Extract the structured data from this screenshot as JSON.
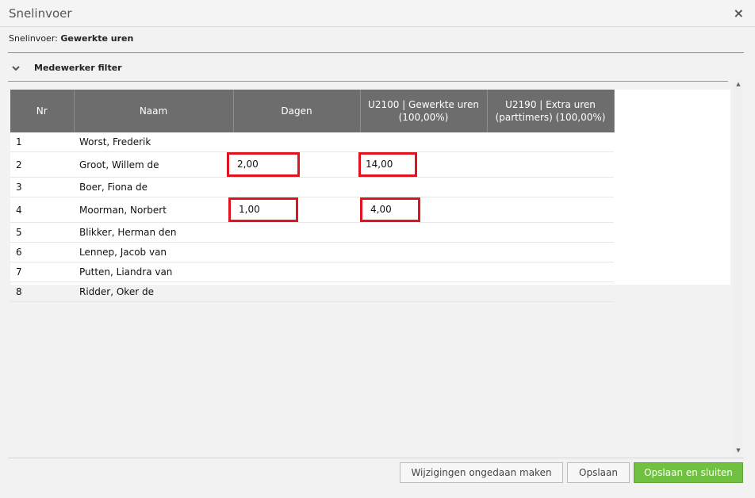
{
  "window": {
    "title": "Snelinvoer",
    "close": "×"
  },
  "subheader": {
    "prefix": "Snelinvoer:",
    "value": "Gewerkte uren"
  },
  "filter": {
    "label": "Medewerker filter"
  },
  "table": {
    "headers": [
      "Nr",
      "Naam",
      "Dagen",
      "U2100 | Gewerkte uren (100,00%)",
      "U2190 | Extra uren (parttimers) (100,00%)"
    ],
    "rows": [
      {
        "nr": "1",
        "naam": "Worst, Frederik",
        "dagen": "",
        "u2100": "",
        "u2190": ""
      },
      {
        "nr": "2",
        "naam": "Groot, Willem de",
        "dagen": "2,00",
        "u2100": "14,00",
        "u2190": ""
      },
      {
        "nr": "3",
        "naam": "Boer, Fiona de",
        "dagen": "",
        "u2100": "",
        "u2190": ""
      },
      {
        "nr": "4",
        "naam": "Moorman, Norbert",
        "dagen": "1,00",
        "u2100": "4,00",
        "u2190": ""
      },
      {
        "nr": "5",
        "naam": "Blikker, Herman den",
        "dagen": "",
        "u2100": "",
        "u2190": ""
      },
      {
        "nr": "6",
        "naam": "Lennep, Jacob van",
        "dagen": "",
        "u2100": "",
        "u2190": ""
      },
      {
        "nr": "7",
        "naam": "Putten, Liandra van",
        "dagen": "",
        "u2100": "",
        "u2190": ""
      },
      {
        "nr": "8",
        "naam": "Ridder, Oker de",
        "dagen": "",
        "u2100": "",
        "u2190": ""
      }
    ]
  },
  "buttons": {
    "undo": "Wijzigingen ongedaan maken",
    "save": "Opslaan",
    "save_close": "Opslaan en sluiten"
  },
  "colors": {
    "header_bg": "#6d6d6d",
    "highlight": "#e0141e",
    "primary": "#70c142"
  }
}
